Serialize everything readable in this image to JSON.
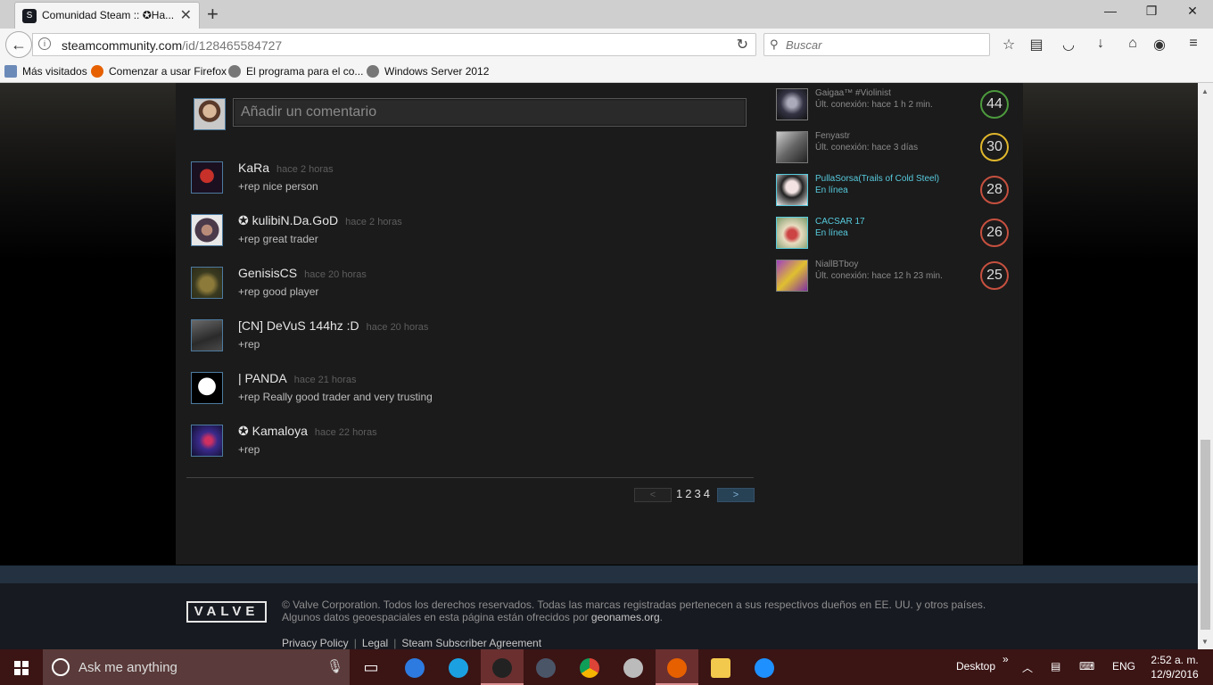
{
  "browser": {
    "tab_title": "Comunidad Steam :: ✪Ha...",
    "url_domain": "steamcommunity.com",
    "url_path": "/id/128465584727",
    "search_placeholder": "Buscar",
    "bookmarks": [
      "Más visitados",
      "Comenzar a usar Firefox",
      "El programa para el co...",
      "Windows Server 2012"
    ]
  },
  "comments": {
    "input_placeholder": "Añadir un comentario",
    "items": [
      {
        "author": "KaRa",
        "time": "hace 2 horas",
        "text": "+rep nice person"
      },
      {
        "author": "✪ kulibiN.Da.GoD",
        "time": "hace 2 horas",
        "text": "+rep great trader"
      },
      {
        "author": "GenisisCS",
        "time": "hace 20 horas",
        "text": "+rep good player"
      },
      {
        "author": "[CN] DeVuS 144hz :D",
        "time": "hace 20 horas",
        "text": "+rep"
      },
      {
        "author": "| PANDA",
        "time": "hace 21 horas",
        "text": "+rep Really good trader and very trusting"
      },
      {
        "author": "✪ Kamaloya",
        "time": "hace 22 horas",
        "text": "+rep"
      }
    ],
    "pager": {
      "prev": "<",
      "pages": [
        "1",
        "2",
        "3",
        "4"
      ],
      "next": ">"
    }
  },
  "friends": [
    {
      "name": "Gaigaa™ #Violinist",
      "status": "Últ. conexión: hace 1 h 2 min.",
      "level": "44",
      "level_color": "#4c9a3d",
      "online": false
    },
    {
      "name": "Fenyastr",
      "status": "Últ. conexión: hace 3 días",
      "level": "30",
      "level_color": "#e0b72c",
      "online": false
    },
    {
      "name": "PullaSorsa(Trails of Cold Steel)",
      "status": "En línea",
      "level": "28",
      "level_color": "#c6503f",
      "online": true
    },
    {
      "name": "CACSAR 17",
      "status": "En línea",
      "level": "26",
      "level_color": "#c6503f",
      "online": true
    },
    {
      "name": "NiallBTboy",
      "status": "Últ. conexión: hace 12 h 23 min.",
      "level": "25",
      "level_color": "#c6503f",
      "online": false
    }
  ],
  "footer": {
    "logo": "VALVE",
    "legal_line1": "© Valve Corporation. Todos los derechos reservados. Todas las marcas registradas pertenecen a sus respectivos dueños en EE. UU. y otros países.",
    "legal_line2": "Algunos datos geoespaciales en esta página están ofrecidos por",
    "geonames": "geonames.org",
    "legal_line2_end": ".",
    "links": [
      "Privacy Policy",
      "Legal",
      "Steam Subscriber Agreement"
    ]
  },
  "taskbar": {
    "search_placeholder": "Ask me anything",
    "desktop": "Desktop",
    "lang": "ENG",
    "time": "2:52 a. m.",
    "date": "12/9/2016"
  }
}
